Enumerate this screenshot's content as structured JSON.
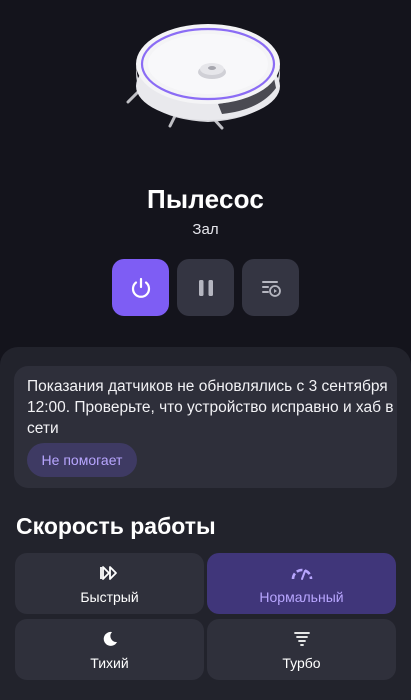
{
  "device": {
    "name": "Пылесос",
    "room": "Зал"
  },
  "controls": [
    {
      "icon": "power-icon",
      "active": true
    },
    {
      "icon": "pause-icon",
      "active": false
    },
    {
      "icon": "program-list-icon",
      "active": false
    }
  ],
  "alert": {
    "text": "Показания датчиков не обновлялись с 3 сентября 12:00. Проверьте, что устройство исправно и хаб в сети",
    "button_label": "Не помогает"
  },
  "speed": {
    "title": "Скорость работы",
    "selected": "Нормальный",
    "options": [
      {
        "label": "Быстрый",
        "icon": "fast-forward-icon"
      },
      {
        "label": "Нормальный",
        "icon": "gauge-icon"
      },
      {
        "label": "Тихий",
        "icon": "moon-icon"
      },
      {
        "label": "Турбо",
        "icon": "tornado-icon"
      }
    ]
  },
  "colors": {
    "background": "#14141c",
    "sheet": "#22232c",
    "accent": "#7e5df4",
    "accent_text": "#b8a6ff"
  }
}
